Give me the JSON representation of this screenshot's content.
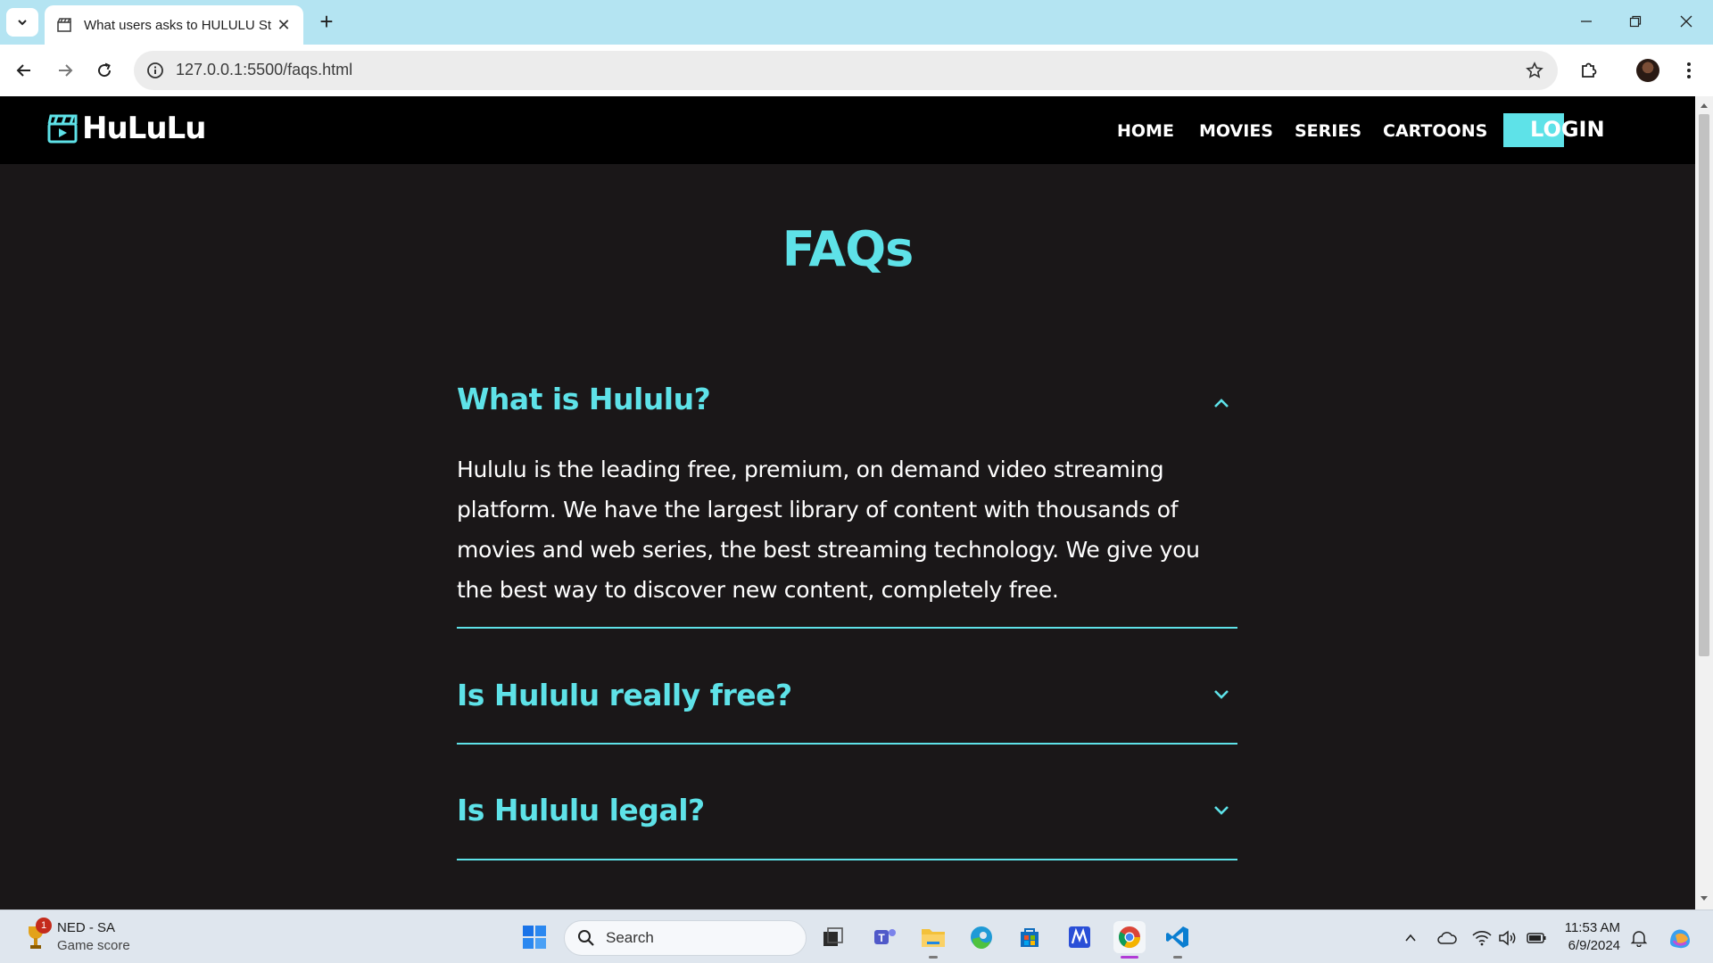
{
  "browser": {
    "tab_title": "What users asks to HULULU Streaming",
    "url": "127.0.0.1:5500/faqs.html",
    "new_tab_label": "+",
    "close_tab_label": "✕"
  },
  "site": {
    "logo_text": "HuLuLu",
    "nav": {
      "home": "HOME",
      "movies": "MOVIES",
      "series": "SERIES",
      "cartoons": "CARTOONS",
      "login": "LOGIN"
    },
    "page_title": "FAQs",
    "faqs": [
      {
        "question": "What is Hululu?",
        "answer": "Hululu is the leading free, premium, on demand video streaming platform. We have the largest library of content with thousands of movies and web series, the best streaming technology. We give you the best way to discover new content, completely free.",
        "expanded": true
      },
      {
        "question": "Is Hululu really free?",
        "answer": "",
        "expanded": false
      },
      {
        "question": "Is Hululu legal?",
        "answer": "",
        "expanded": false
      }
    ],
    "accent_color": "#5ee2e8"
  },
  "taskbar": {
    "widget_title": "NED - SA",
    "widget_subtitle": "Game score",
    "widget_badge": "1",
    "search_placeholder": "Search",
    "time": "11:53 AM",
    "date": "6/9/2024"
  },
  "icons": {
    "tab_menu": "chevron-down-icon",
    "favicon": "clapperboard-icon",
    "back": "arrow-left-icon",
    "forward": "arrow-right-icon",
    "reload": "reload-icon",
    "site_info": "info-icon",
    "bookmark": "star-icon",
    "extensions": "puzzle-icon",
    "menu": "kebab-icon"
  }
}
